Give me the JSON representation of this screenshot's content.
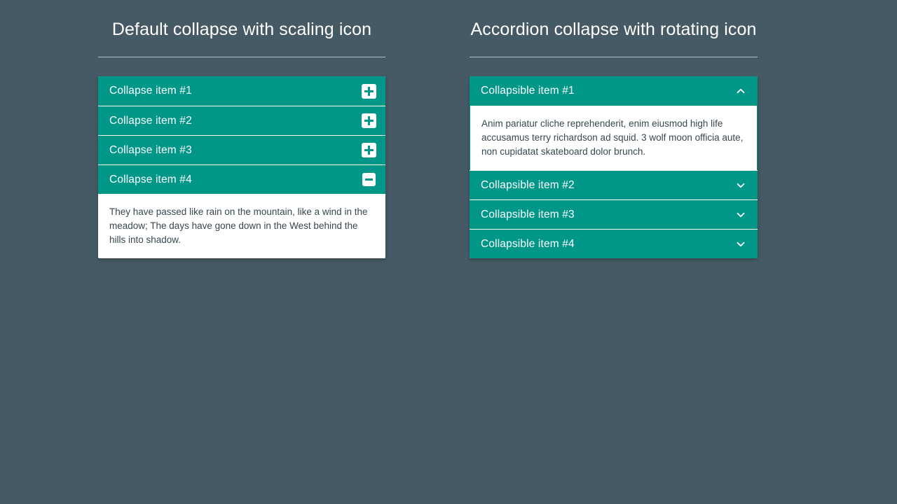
{
  "theme": {
    "background": "#455a64",
    "accent": "#009688",
    "panel_background": "#ffffff",
    "body_text": "#37474f",
    "header_text": "#ffffff",
    "rule": "#c9d1d6"
  },
  "panels": [
    {
      "key": "default_collapse",
      "title": "Default collapse with scaling icon",
      "items": [
        {
          "label": "Collapse item #1",
          "icon": "plus-icon",
          "expanded": false,
          "body": ""
        },
        {
          "label": "Collapse item #2",
          "icon": "plus-icon",
          "expanded": false,
          "body": ""
        },
        {
          "label": "Collapse item #3",
          "icon": "plus-icon",
          "expanded": false,
          "body": ""
        },
        {
          "label": "Collapse item #4",
          "icon": "minus-icon",
          "expanded": true,
          "body": "They have passed like rain on the mountain, like a wind in the meadow; The days have gone down in the West behind the hills into shadow."
        }
      ]
    },
    {
      "key": "accordion_collapse",
      "title": "Accordion collapse with rotating icon",
      "items": [
        {
          "label": "Collapsible item #1",
          "icon": "chevron-up-icon",
          "expanded": true,
          "body": "Anim pariatur cliche reprehenderit, enim eiusmod high life accusamus terry richardson ad squid. 3 wolf moon officia aute, non cupidatat skateboard dolor brunch."
        },
        {
          "label": "Collapsible item #2",
          "icon": "chevron-down-icon",
          "expanded": false,
          "body": ""
        },
        {
          "label": "Collapsible item #3",
          "icon": "chevron-down-icon",
          "expanded": false,
          "body": ""
        },
        {
          "label": "Collapsible item #4",
          "icon": "chevron-down-icon",
          "expanded": false,
          "body": ""
        }
      ]
    }
  ]
}
